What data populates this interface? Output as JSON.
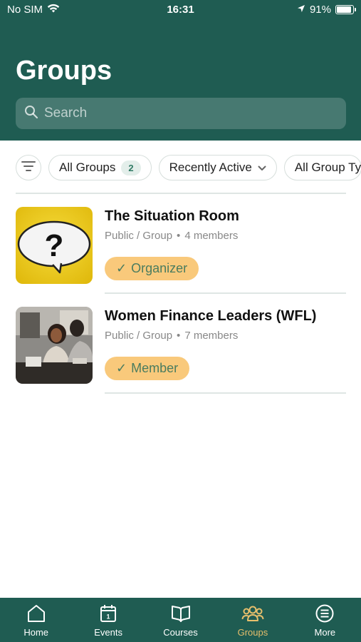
{
  "status_bar": {
    "carrier": "No SIM",
    "time": "16:31",
    "battery": "91%",
    "battery_level": 0.91
  },
  "header": {
    "title": "Groups"
  },
  "search": {
    "placeholder": "Search"
  },
  "filters": {
    "all_groups_label": "All Groups",
    "all_groups_count": "2",
    "sort_label": "Recently Active",
    "type_label": "All Group Ty"
  },
  "groups": [
    {
      "name": "The Situation Room",
      "visibility": "Public / Group",
      "members": "4 members",
      "role": "Organizer"
    },
    {
      "name": "Women Finance Leaders (WFL)",
      "visibility": "Public / Group",
      "members": "7 members",
      "role": "Member"
    }
  ],
  "tabs": [
    {
      "label": "Home",
      "icon": "home-icon"
    },
    {
      "label": "Events",
      "icon": "calendar-icon"
    },
    {
      "label": "Courses",
      "icon": "book-icon"
    },
    {
      "label": "Groups",
      "icon": "groups-icon",
      "active": true
    },
    {
      "label": "More",
      "icon": "menu-icon"
    }
  ],
  "colors": {
    "header_bg": "#1f5c52",
    "active_tab": "#e7bf6c",
    "role_badge": "#f9c97b"
  }
}
